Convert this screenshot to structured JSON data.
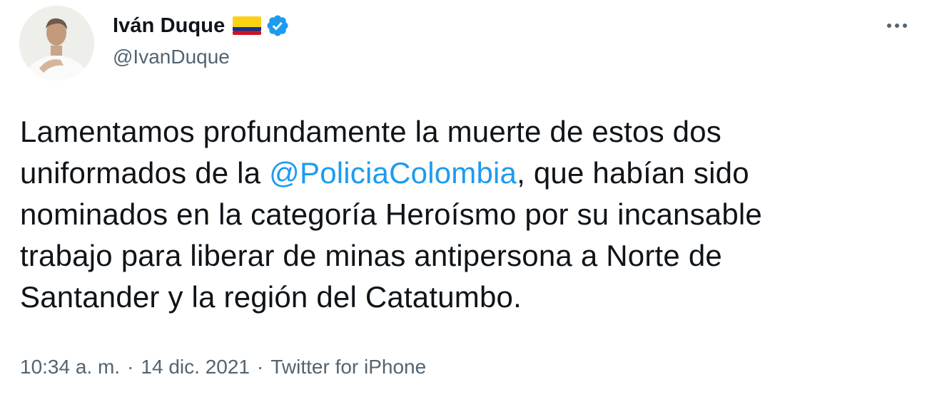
{
  "author": {
    "display_name": "Iván Duque",
    "handle": "@IvanDuque",
    "flag_icon": "colombia-flag-emoji",
    "verified_icon": "verified-badge-icon",
    "verified_color": "#1d9bf0"
  },
  "more_icon": "more-horizontal-icon",
  "tweet": {
    "line1": "Lamentamos profundamente la muerte de estos dos",
    "line2_before": "uniformados de la ",
    "mention": "@PoliciaColombia",
    "line2_after": ", que habían sido",
    "line3": "nominados en la categoría Heroísmo por su incansable",
    "line4": "trabajo para liberar de minas antipersona a Norte de",
    "line5": "Santander y la región del Catatumbo."
  },
  "meta": {
    "time": "10:34 a. m.",
    "separator": "·",
    "date": "14 dic. 2021",
    "source": "Twitter for iPhone"
  },
  "colors": {
    "text": "#0f1419",
    "secondary": "#536471",
    "link": "#1d9bf0"
  }
}
